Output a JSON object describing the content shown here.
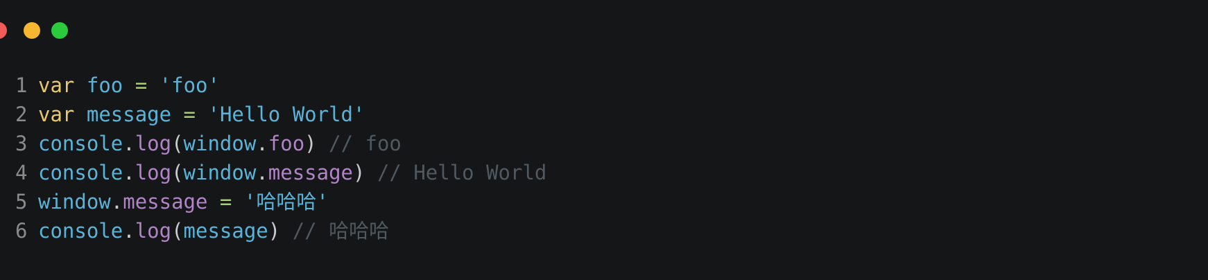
{
  "window_controls": {
    "close_color": "#f25b57",
    "minimize_color": "#f7b731",
    "maximize_color": "#2bcb3e"
  },
  "editor": {
    "lines": [
      {
        "number": "1",
        "tokens": [
          {
            "text": "var",
            "type": "keyword"
          },
          {
            "text": " ",
            "type": "space"
          },
          {
            "text": "foo",
            "type": "ident"
          },
          {
            "text": " ",
            "type": "space"
          },
          {
            "text": "=",
            "type": "op"
          },
          {
            "text": " ",
            "type": "space"
          },
          {
            "text": "'foo'",
            "type": "string"
          }
        ]
      },
      {
        "number": "2",
        "tokens": [
          {
            "text": "var",
            "type": "keyword"
          },
          {
            "text": " ",
            "type": "space"
          },
          {
            "text": "message",
            "type": "ident"
          },
          {
            "text": " ",
            "type": "space"
          },
          {
            "text": "=",
            "type": "op"
          },
          {
            "text": " ",
            "type": "space"
          },
          {
            "text": "'Hello World'",
            "type": "string"
          }
        ]
      },
      {
        "number": "3",
        "tokens": [
          {
            "text": "console",
            "type": "ident"
          },
          {
            "text": ".",
            "type": "punct"
          },
          {
            "text": "log",
            "type": "prop"
          },
          {
            "text": "(",
            "type": "punct"
          },
          {
            "text": "window",
            "type": "ident"
          },
          {
            "text": ".",
            "type": "punct"
          },
          {
            "text": "foo",
            "type": "prop"
          },
          {
            "text": ")",
            "type": "punct"
          },
          {
            "text": " ",
            "type": "space"
          },
          {
            "text": "// foo",
            "type": "comment"
          }
        ]
      },
      {
        "number": "4",
        "tokens": [
          {
            "text": "console",
            "type": "ident"
          },
          {
            "text": ".",
            "type": "punct"
          },
          {
            "text": "log",
            "type": "prop"
          },
          {
            "text": "(",
            "type": "punct"
          },
          {
            "text": "window",
            "type": "ident"
          },
          {
            "text": ".",
            "type": "punct"
          },
          {
            "text": "message",
            "type": "prop"
          },
          {
            "text": ")",
            "type": "punct"
          },
          {
            "text": " ",
            "type": "space"
          },
          {
            "text": "// Hello World",
            "type": "comment"
          }
        ]
      },
      {
        "number": "5",
        "tokens": [
          {
            "text": "window",
            "type": "ident"
          },
          {
            "text": ".",
            "type": "punct"
          },
          {
            "text": "message",
            "type": "prop"
          },
          {
            "text": " ",
            "type": "space"
          },
          {
            "text": "=",
            "type": "op"
          },
          {
            "text": " ",
            "type": "space"
          },
          {
            "text": "'哈哈哈'",
            "type": "string"
          }
        ]
      },
      {
        "number": "6",
        "tokens": [
          {
            "text": "console",
            "type": "ident"
          },
          {
            "text": ".",
            "type": "punct"
          },
          {
            "text": "log",
            "type": "prop"
          },
          {
            "text": "(",
            "type": "punct"
          },
          {
            "text": "message",
            "type": "ident"
          },
          {
            "text": ")",
            "type": "punct"
          },
          {
            "text": " ",
            "type": "space"
          },
          {
            "text": "// 哈哈哈",
            "type": "comment"
          }
        ]
      }
    ]
  }
}
